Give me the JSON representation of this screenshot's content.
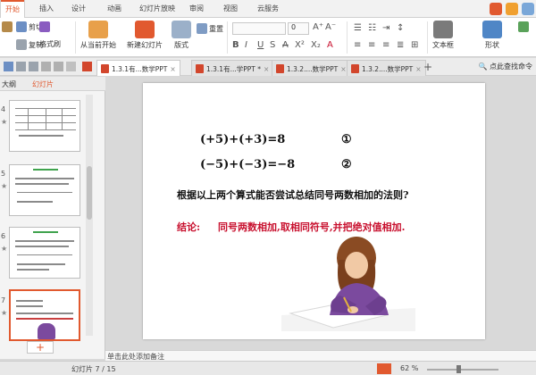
{
  "colors": {
    "accent": "#e1592f",
    "conclusion_red": "#c8102e"
  },
  "ribbon_tabs": [
    "开始",
    "插入",
    "设计",
    "动画",
    "幻灯片放映",
    "审阅",
    "视图",
    "云服务"
  ],
  "ribbon": {
    "cut": "剪切",
    "copy": "复制",
    "format_painter": "格式刷",
    "from_current": "从当前开始",
    "new_slide": "新建幻灯片",
    "layout": "版式",
    "reset": "重置",
    "font_size": "0",
    "textbox": "文本框",
    "shape": "形状"
  },
  "doc_tabs": [
    {
      "title": "1.3.1有...数学PPT",
      "close": "×"
    },
    {
      "title": "1.3.1有...学PPT *",
      "close": "×"
    },
    {
      "title": "1.3.2....数学PPT",
      "close": "×"
    },
    {
      "title": "1.3.2....数学PPT",
      "close": "×"
    }
  ],
  "search_tip": "点此查找命令",
  "left_panel": {
    "outline_tab": "大纲",
    "slides_tab": "幻灯片",
    "thumb_nums": [
      "4",
      "5",
      "6",
      "7"
    ],
    "add": "+"
  },
  "slide": {
    "eq1": "(+5)+(+3)=8",
    "eq1_num": "①",
    "eq2": "(−5)+(−3)=−8",
    "eq2_num": "②",
    "question": "根据以上两个算式能否尝试总结同号两数相加的法则?",
    "conclusion_label": "结论:",
    "conclusion_text": "同号两数相加,取相同符号,并把绝对值相加."
  },
  "notes_placeholder": "单击此处添加备注",
  "status": {
    "slide_counter": "幻灯片 7 / 15",
    "zoom": "62 %"
  }
}
